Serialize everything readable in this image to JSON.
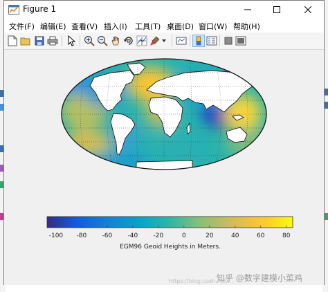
{
  "window": {
    "title": "Figure 1"
  },
  "menu": [
    {
      "label": "文件(F)"
    },
    {
      "label": "编辑(E)"
    },
    {
      "label": "查看(V)"
    },
    {
      "label": "插入(I)"
    },
    {
      "label": "工具(T)"
    },
    {
      "label": "桌面(D)"
    },
    {
      "label": "窗口(W)"
    },
    {
      "label": "帮助(H)"
    }
  ],
  "toolbar": {
    "buttons": [
      "new-figure-icon",
      "open-file-icon",
      "save-icon",
      "print-icon",
      "pointer-icon",
      "zoom-in-icon",
      "zoom-out-icon",
      "pan-icon",
      "rotate-3d-icon",
      "data-cursor-icon",
      "brush-icon",
      "link-plot-icon",
      "colorbar-icon",
      "legend-icon",
      "hide-plot-tools-icon",
      "show-plot-tools-icon"
    ]
  },
  "chart_data": {
    "type": "heatmap",
    "projection": "Robinson",
    "colorbar": {
      "ticks": [
        "-100",
        "-80",
        "-60",
        "-40",
        "-20",
        "0",
        "20",
        "40",
        "60",
        "80"
      ],
      "tick_values": [
        -100,
        -80,
        -60,
        -40,
        -20,
        0,
        20,
        40,
        60,
        80
      ],
      "range": [
        -107,
        85
      ],
      "label": "EGM96 Geoid Heights in Meters.",
      "colormap": "parula"
    }
  },
  "watermark": {
    "text": "知乎 @数字建模小菜鸡",
    "small": "https://blog.csdn.net/..."
  },
  "colors": {
    "titlebar": "#ffffff",
    "figure_bg": "#f0f0f0",
    "toolbar_active": "#cce4f7"
  }
}
